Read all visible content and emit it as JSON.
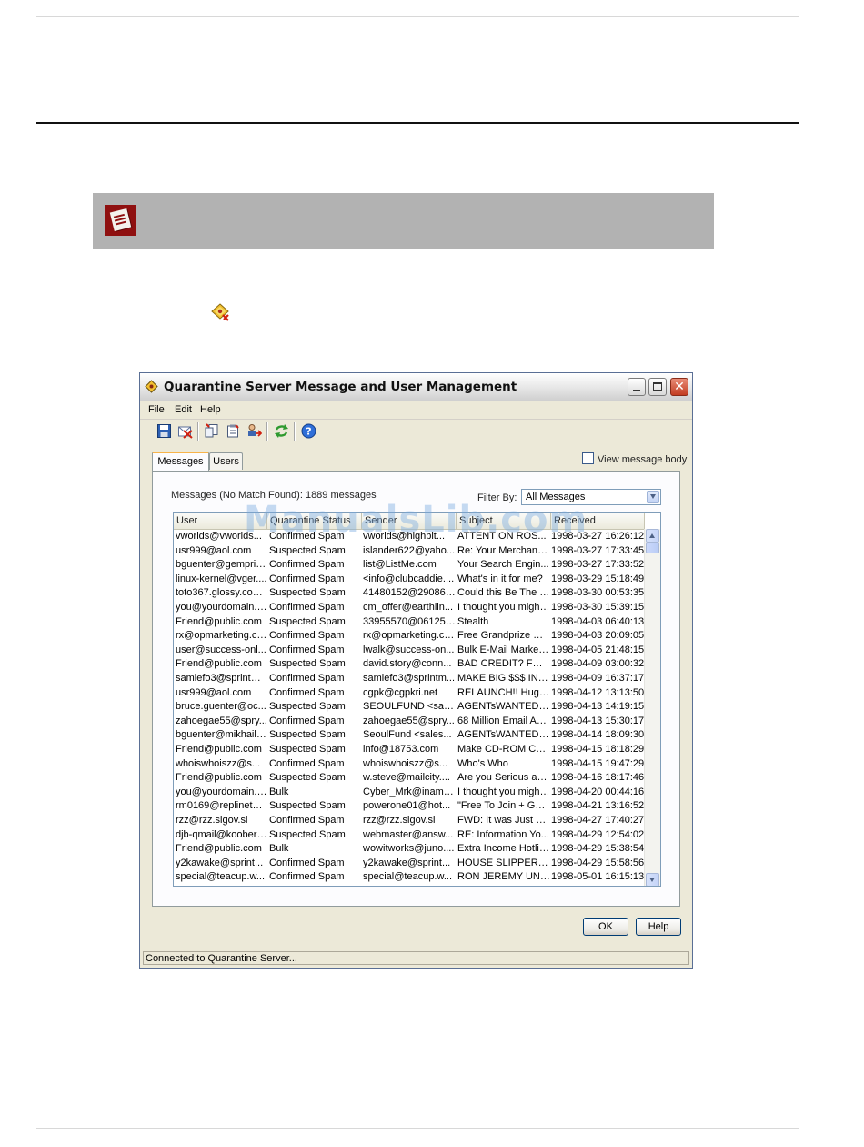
{
  "window": {
    "title": "Quarantine Server Message and User Management",
    "close_glyph": "✕"
  },
  "menu": [
    "File",
    "Edit",
    "Help"
  ],
  "toolbar_icons": [
    "save-icon",
    "delete-message-icon",
    "copy-icon",
    "paste-icon",
    "move-user-icon",
    "refresh-icon",
    "help-icon"
  ],
  "view_message_body": {
    "label": "View message body",
    "checked": false
  },
  "tabs": [
    {
      "label": "Messages",
      "active": true
    },
    {
      "label": "Users",
      "active": false
    }
  ],
  "messages_count_text": "Messages (No Match Found): 1889 messages",
  "filter": {
    "label": "Filter By:",
    "value": "All Messages"
  },
  "table": {
    "columns": [
      "User",
      "Quarantine Status",
      "Sender",
      "Subject",
      "Received"
    ],
    "rows": [
      [
        "vworlds@vworlds...",
        "Confirmed Spam",
        "vworlds@highbit...",
        "ATTENTION ROS...",
        "1998-03-27 16:26:12"
      ],
      [
        "usr999@aol.com",
        "Suspected Spam",
        "islander622@yaho...",
        "Re: Your Merchant ...",
        "1998-03-27 17:33:45"
      ],
      [
        "bguenter@gemprin...",
        "Confirmed Spam",
        "list@ListMe.com",
        "Your Search Engin...",
        "1998-03-27 17:33:52"
      ],
      [
        "linux-kernel@vger....",
        "Confirmed Spam",
        "<info@clubcaddie....",
        "What's in it for me?",
        "1998-03-29 15:18:49"
      ],
      [
        "toto367.glossy.com...",
        "Suspected Spam",
        "41480152@29086....",
        "Could this Be The M...",
        "1998-03-30 00:53:35"
      ],
      [
        "you@yourdomain.net",
        "Confirmed Spam",
        "cm_offer@earthlin...",
        "I thought you might ...",
        "1998-03-30 15:39:15"
      ],
      [
        "Friend@public.com",
        "Suspected Spam",
        "33955570@06125....",
        "Stealth",
        "1998-04-03 06:40:13"
      ],
      [
        "rx@opmarketing.com",
        "Confirmed Spam",
        "rx@opmarketing.com",
        "Free Grandprize Dr...",
        "1998-04-03 20:09:05"
      ],
      [
        "user@success-onl...",
        "Confirmed Spam",
        "lwalk@success-on...",
        "Bulk E-Mail Marketin...",
        "1998-04-05 21:48:15"
      ],
      [
        "Friend@public.com",
        "Suspected Spam",
        "david.story@conn...",
        "BAD CREDIT? FOR...",
        "1998-04-09 03:00:32"
      ],
      [
        "samiefo3@sprintm...",
        "Confirmed Spam",
        "samiefo3@sprintm...",
        "MAKE BIG $$$ IN Y...",
        "1998-04-09 16:37:17"
      ],
      [
        "usr999@aol.com",
        "Confirmed Spam",
        "cgpk@cgpkri.net",
        "RELAUNCH!! Huge ...",
        "1998-04-12 13:13:50"
      ],
      [
        "bruce.guenter@oc...",
        "Suspected Spam",
        "SEOULFUND <sale...",
        "AGENTsWANTEDn...",
        "1998-04-13 14:19:15"
      ],
      [
        "zahoegae55@spry...",
        "Confirmed Spam",
        "zahoegae55@spry...",
        "68 Million Email Add...",
        "1998-04-13 15:30:17"
      ],
      [
        "bguenter@mikhail.q...",
        "Suspected Spam",
        "SeoulFund <sales...",
        "AGENTsWANTEDn...",
        "1998-04-14 18:09:30"
      ],
      [
        "Friend@public.com",
        "Suspected Spam",
        "info@18753.com",
        "Make CD-ROM Cop...",
        "1998-04-15 18:18:29"
      ],
      [
        "whoiswhoiszz@s...",
        "Confirmed Spam",
        "whoiswhoiszz@s...",
        "Who's Who",
        "1998-04-15 19:47:29"
      ],
      [
        "Friend@public.com",
        "Suspected Spam",
        "w.steve@mailcity....",
        "Are you Serious ab...",
        "1998-04-16 18:17:46"
      ],
      [
        "you@yourdomain.net",
        "Bulk",
        "Cyber_Mrk@iname....",
        "I thought you might ...",
        "1998-04-20 00:44:16"
      ],
      [
        "rm0169@replinets-...",
        "Suspected Spam",
        "powerone01@hot...",
        "\"Free To Join + Gua...",
        "1998-04-21 13:16:52"
      ],
      [
        "rzz@rzz.sigov.si",
        "Confirmed Spam",
        "rzz@rzz.sigov.si",
        "FWD:  It was Just R...",
        "1998-04-27 17:40:27"
      ],
      [
        "djb-qmail@koobera...",
        "Suspected Spam",
        "webmaster@answ...",
        "RE:  Information Yo...",
        "1998-04-29 12:54:02"
      ],
      [
        "Friend@public.com",
        "Bulk",
        "wowitworks@juno....",
        "Extra Income Hotline",
        "1998-04-29 15:38:54"
      ],
      [
        "y2kawake@sprint...",
        "Confirmed Spam",
        "y2kawake@sprint...",
        "HOUSE SLIPPERS R...",
        "1998-04-29 15:58:56"
      ],
      [
        "special@teacup.w...",
        "Confirmed Spam",
        "special@teacup.w...",
        "RON JEREMY UNPL...",
        "1998-05-01 16:15:13"
      ]
    ]
  },
  "buttons": {
    "ok": "OK",
    "help": "Help"
  },
  "status_text": "Connected to Quarantine Server...",
  "watermark": "ManualsLib.com",
  "colors": {
    "note_icon": "#8f1010",
    "note_band": "#b2b2b2",
    "close_button": "#c33d22"
  }
}
